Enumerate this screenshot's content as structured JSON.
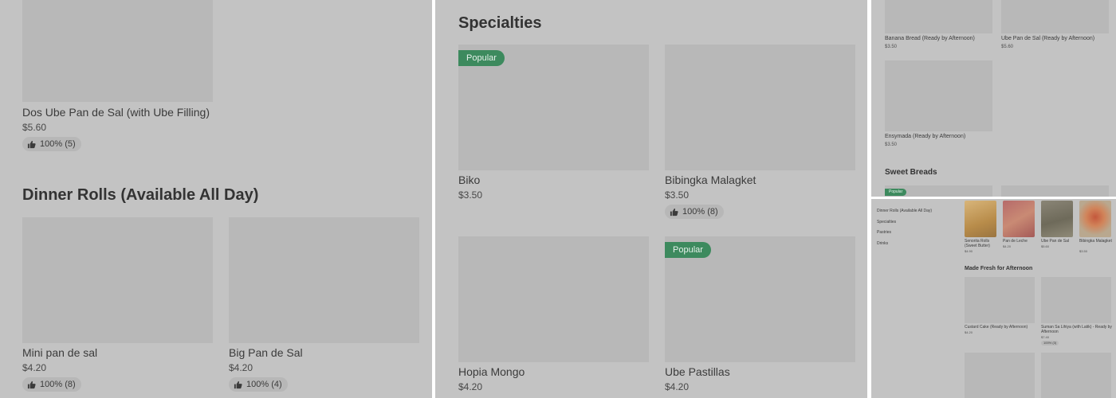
{
  "panel_a": {
    "item_top": {
      "name": "Dos Ube Pan de Sal (with Ube Filling)",
      "price": "$5.60",
      "rating": "100% (5)"
    },
    "section_title": "Dinner Rolls (Available All Day)",
    "items": [
      {
        "name": "Mini pan de sal",
        "price": "$4.20",
        "rating": "100% (8)"
      },
      {
        "name": "Big Pan de Sal",
        "price": "$4.20",
        "rating": "100% (4)"
      }
    ]
  },
  "panel_b": {
    "section_title": "Specialties",
    "items": [
      {
        "name": "Biko",
        "price": "$3.50",
        "badge": "Popular"
      },
      {
        "name": "Bibingka Malagket",
        "price": "$3.50",
        "rating": "100% (8)"
      },
      {
        "name": "Hopia Mongo",
        "price": "$4.20"
      },
      {
        "name": "Ube Pastillas",
        "price": "$4.20",
        "badge": "Popular"
      }
    ]
  },
  "panel_c": {
    "items": [
      {
        "name": "Banana Bread (Ready by Afternoon)",
        "price": "$3.50"
      },
      {
        "name": "Ube Pan de Sal (Ready by Afternoon)",
        "price": "$5.60"
      },
      {
        "name": "Ensymada (Ready by Afternoon)",
        "price": "$3.50"
      }
    ],
    "section_title": "Sweet Breads",
    "badge": "Popular"
  },
  "panel_d": {
    "nav": [
      "Dinner Rolls (Available All Day)",
      "Specialties",
      "Pastries",
      "Drinks"
    ],
    "photo_items": [
      {
        "name": "Senorita Rolls (Sweet Butter)",
        "price": "$4.90"
      },
      {
        "name": "Pan de Leche",
        "price": "$4.20"
      },
      {
        "name": "Ube Pan de Sal",
        "price": "$5.60"
      },
      {
        "name": "Bibingka Malagket",
        "price": "$3.50"
      }
    ],
    "section_title": "Made Fresh for Afternoon",
    "items": [
      {
        "name": "Custard Cake (Ready by Afternoon)",
        "price": "$4.20"
      },
      {
        "name": "Suman Sa Lihiya (with Latik) - Ready by Afternoon",
        "price": "$7.40",
        "rating": "100% (3)"
      }
    ]
  },
  "colors": {
    "panel_bg": "#c3c3c3",
    "placeholder": "#b8b8b8",
    "badge_green": "#3d8a5e",
    "divider": "#ffffff"
  }
}
